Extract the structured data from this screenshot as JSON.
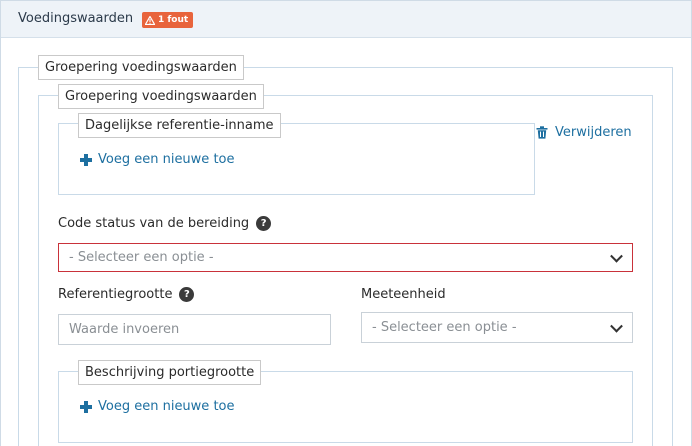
{
  "header": {
    "title": "Voedingswaarden",
    "error_badge": "1 fout"
  },
  "outer_group": {
    "legend": "Groepering voedingswaarden"
  },
  "inner_group": {
    "legend": "Groepering voedingswaarden",
    "delete_label": "Verwijderen",
    "daily_reference": {
      "legend": "Dagelijkse referentie-inname",
      "add_label": "Voeg een nieuwe toe"
    },
    "preparation_status": {
      "label": "Code status van de bereiding",
      "help": "?",
      "selected": "- Selecteer een optie -"
    },
    "reference_size": {
      "label": "Referentiegrootte",
      "help": "?",
      "placeholder": "Waarde invoeren"
    },
    "unit": {
      "label": "Meeteenheid",
      "selected": "- Selecteer een optie -"
    },
    "portion_description": {
      "legend": "Beschrijving portiegrootte",
      "add_label": "Voeg een nieuwe toe"
    }
  },
  "colors": {
    "accent": "#1d6fa0",
    "error": "#c9323a",
    "badge": "#e8643c"
  }
}
